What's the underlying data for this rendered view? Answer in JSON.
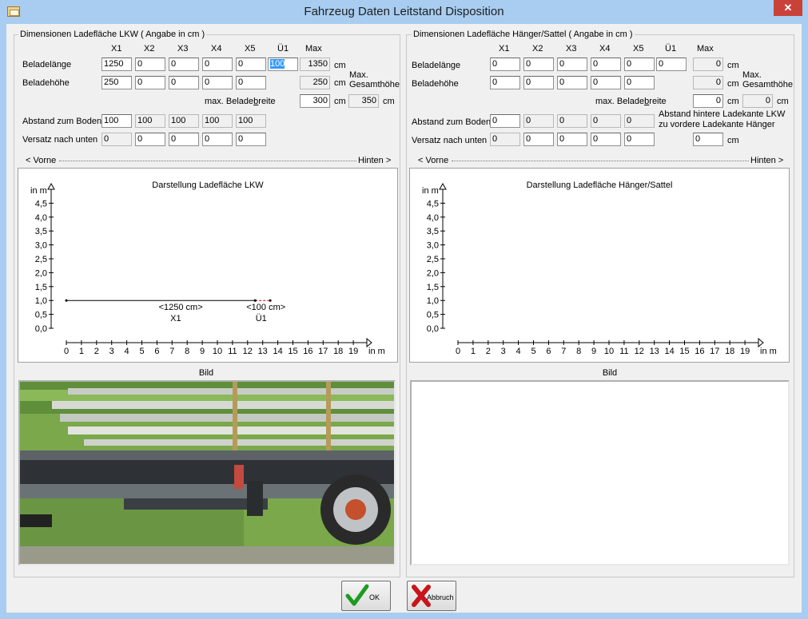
{
  "window": {
    "title": "Fahrzeug Daten Leitstand Disposition",
    "close_label": "✕"
  },
  "columns": [
    "X1",
    "X2",
    "X3",
    "X4",
    "X5",
    "Ü1",
    "Max"
  ],
  "lkw": {
    "group_title": "Dimensionen Ladefläche LKW ( Angabe in cm )",
    "beladelaenge_label": "Beladelänge",
    "beladelaenge_values": [
      "1250",
      "0",
      "0",
      "0",
      "0",
      "100"
    ],
    "beladelaenge_max": "1350",
    "beladehoehe_label": "Beladehöhe",
    "beladehoehe_values": [
      "250",
      "0",
      "0",
      "0",
      "0"
    ],
    "beladehoehe_max": "250",
    "unit_cm": "cm",
    "max_gesamthoehe_label_1": "Max.",
    "max_gesamthoehe_label_2": "Gesamthöhe",
    "max_beladebreite_label_pre": "max. Belade",
    "max_beladebreite_label_u": "b",
    "max_beladebreite_label_post": "reite",
    "max_beladebreite_value": "300",
    "gesamthoehe_value": "350",
    "abstand_boden_label": "Abstand zum Boden",
    "abstand_boden_values": [
      "100",
      "100",
      "100",
      "100",
      "100"
    ],
    "versatz_label": "Versatz nach unten",
    "versatz_values": [
      "0",
      "0",
      "0",
      "0",
      "0"
    ],
    "vorne_label": "< Vorne",
    "hinten_label": "Hinten >",
    "chart_title": "Darstellung Ladefläche LKW",
    "bild_label": "Bild"
  },
  "haenger": {
    "group_title": "Dimensionen Ladefläche Hänger/Sattel ( Angabe in cm )",
    "beladelaenge_label": "Beladelänge",
    "beladelaenge_values": [
      "0",
      "0",
      "0",
      "0",
      "0",
      "0"
    ],
    "beladelaenge_max": "0",
    "beladehoehe_label": "Beladehöhe",
    "beladehoehe_values": [
      "0",
      "0",
      "0",
      "0",
      "0"
    ],
    "beladehoehe_max": "0",
    "unit_cm": "cm",
    "max_gesamthoehe_label_1": "Max.",
    "max_gesamthoehe_label_2": "Gesamthöhe",
    "max_beladebreite_label_pre": "max. Belade",
    "max_beladebreite_label_u": "b",
    "max_beladebreite_label_post": "reite",
    "max_beladebreite_value": "0",
    "gesamthoehe_value": "0",
    "abstand_boden_label": "Abstand zum Boden",
    "abstand_boden_values": [
      "0",
      "0",
      "0",
      "0",
      "0"
    ],
    "versatz_label": "Versatz nach unten",
    "versatz_values": [
      "0",
      "0",
      "0",
      "0",
      "0"
    ],
    "abstand_haenger_label_1": "Abstand hintere Ladekante LKW",
    "abstand_haenger_label_2": "zu vordere Ladekante Hänger",
    "abstand_haenger_value": "0",
    "vorne_label": "< Vorne",
    "hinten_label": "Hinten >",
    "chart_title": "Darstellung Ladefläche Hänger/Sattel",
    "bild_label": "Bild"
  },
  "axis": {
    "y_unit": "in m",
    "x_unit": "in m",
    "y_ticks": [
      "0,0",
      "0,5",
      "1,0",
      "1,5",
      "2,0",
      "2,5",
      "3,0",
      "3,5",
      "4,0",
      "4,5"
    ],
    "x_ticks": [
      "0",
      "1",
      "2",
      "3",
      "4",
      "5",
      "6",
      "7",
      "8",
      "9",
      "10",
      "11",
      "12",
      "13",
      "14",
      "15",
      "16",
      "17",
      "18",
      "19"
    ]
  },
  "chart_data": [
    {
      "type": "line",
      "title": "Darstellung Ladefläche LKW",
      "ylabel": "in m",
      "xlabel": "in m",
      "ylim": [
        0,
        4.5
      ],
      "xlim": [
        0,
        19
      ],
      "segments": [
        {
          "name": "X1",
          "label": "<1250 cm>",
          "x_start": 0,
          "x_end": 12.5,
          "y": 1.0,
          "style": "solid",
          "color": "#000000"
        },
        {
          "name": "Ü1",
          "label": "<100 cm>",
          "x_start": 12.5,
          "x_end": 13.5,
          "y": 1.0,
          "style": "dashed",
          "color": "#c00000"
        }
      ]
    },
    {
      "type": "line",
      "title": "Darstellung Ladefläche Hänger/Sattel",
      "ylabel": "in m",
      "xlabel": "in m",
      "ylim": [
        0,
        4.5
      ],
      "xlim": [
        0,
        19
      ],
      "segments": []
    }
  ],
  "buttons": {
    "ok_label": "OK",
    "cancel_label": "Abbruch"
  }
}
